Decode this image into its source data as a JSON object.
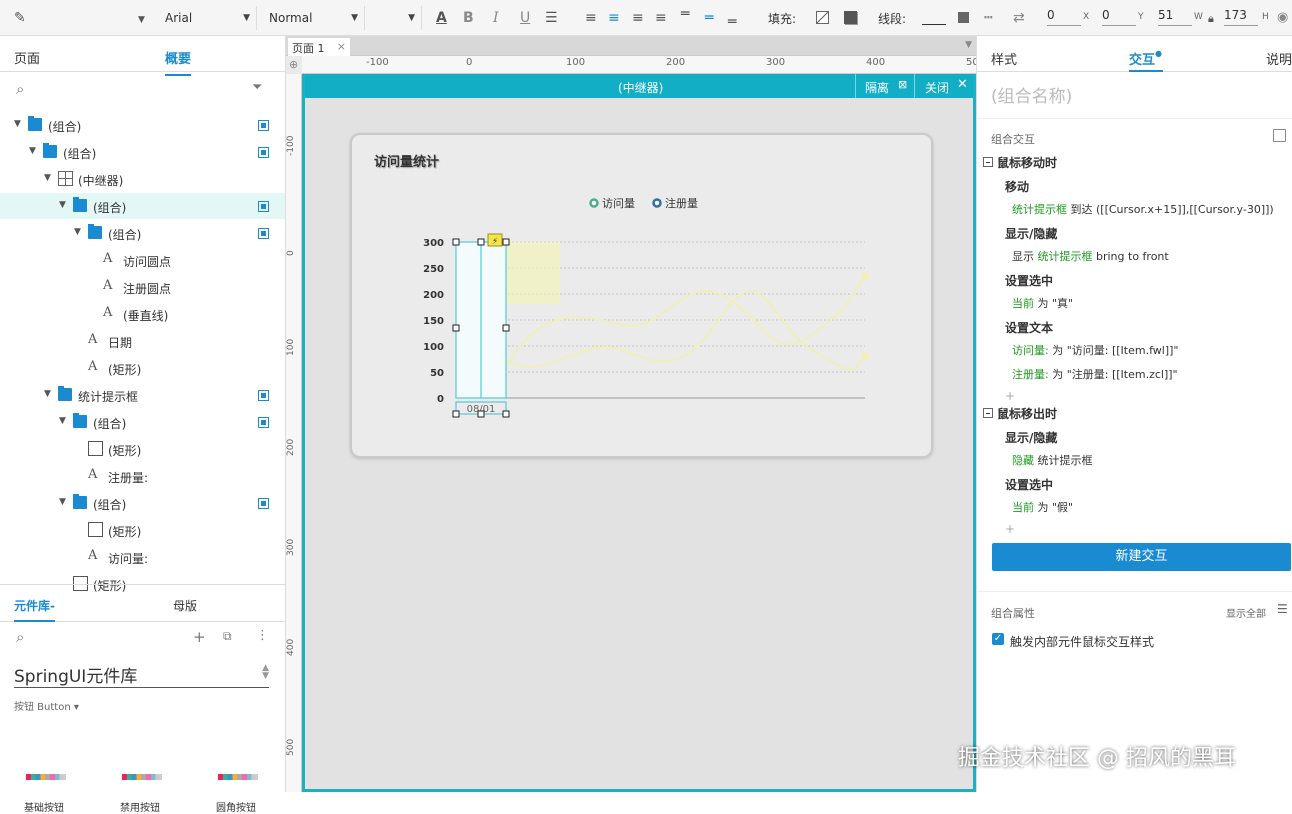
{
  "toolbar": {
    "font_family": "Arial",
    "font_style": "Normal",
    "fill_label": "填充:",
    "stroke_label": "线段:",
    "x_value": "0",
    "x_unit": "X",
    "y_value": "0",
    "y_unit": "Y",
    "w_value": "51",
    "w_unit": "W",
    "h_value": "173",
    "h_unit": "H"
  },
  "left": {
    "tab_pages": "页面",
    "tab_outline": "概要",
    "tree": [
      {
        "label": "(组合)",
        "icon": "folder"
      },
      {
        "label": "(组合)",
        "icon": "folder"
      },
      {
        "label": "(中继器)",
        "icon": "repeater"
      },
      {
        "label": "(组合)",
        "icon": "folder"
      },
      {
        "label": "(组合)",
        "icon": "folder"
      },
      {
        "label": "访问圆点",
        "icon": "text"
      },
      {
        "label": "注册圆点",
        "icon": "text"
      },
      {
        "label": "(垂直线)",
        "icon": "text"
      },
      {
        "label": "日期",
        "icon": "text"
      },
      {
        "label": "(矩形)",
        "icon": "text"
      },
      {
        "label": "统计提示框",
        "icon": "folder"
      },
      {
        "label": "(组合)",
        "icon": "folder"
      },
      {
        "label": "(矩形)",
        "icon": "rect"
      },
      {
        "label": "注册量:",
        "icon": "text"
      },
      {
        "label": "(组合)",
        "icon": "folder"
      },
      {
        "label": "(矩形)",
        "icon": "rect"
      },
      {
        "label": "访问量:",
        "icon": "text"
      },
      {
        "label": "(矩形)",
        "icon": "rect"
      }
    ],
    "lib_tab": "元件库-",
    "master_tab": "母版",
    "library_name": "SpringUI元件库",
    "category": "按钮 Button ▾",
    "widgets": [
      "基础按钮",
      "禁用按钮",
      "圆角按钮"
    ]
  },
  "canvas": {
    "page_tab": "页面 1",
    "page_tab_close": "×",
    "ruler_h": [
      "-100",
      "0",
      "100",
      "200",
      "300",
      "400",
      "500"
    ],
    "ruler_v": [
      "-100",
      "0",
      "100",
      "200",
      "300",
      "400",
      "500"
    ],
    "repeater_title": "(中继器)",
    "isolate_label": "隔离",
    "close_label": "关闭",
    "chart_title": "访问量统计",
    "legend": [
      "访问量",
      "注册量"
    ],
    "date_label": "08/01",
    "lightning_icon": "⚡"
  },
  "chart_data": {
    "type": "line",
    "title": "访问量统计",
    "ylim": [
      0,
      300
    ],
    "yticks": [
      "300",
      "250",
      "200",
      "150",
      "100",
      "50",
      "0"
    ],
    "x_label_shown": "08/01",
    "series": [
      {
        "name": "访问量",
        "color": "#4caf87"
      },
      {
        "name": "注册量",
        "color": "#2f6fa5"
      }
    ],
    "grid": true,
    "legend_position": "top-center"
  },
  "right": {
    "tab_style": "样式",
    "tab_interaction": "交互",
    "tab_notes": "说明",
    "name_placeholder": "(组合名称)",
    "group_interactions": "组合交互",
    "events": [
      {
        "event": "鼠标移动时",
        "actions": [
          {
            "title": "移动",
            "lines": [
              [
                "统计提示框",
                " 到达 ([[Cursor.x+15]],[[Cursor.y-30]])"
              ]
            ]
          },
          {
            "title": "显示/隐藏",
            "lines": [
              [
                "显示 ",
                "统计提示框",
                " bring to front"
              ]
            ]
          },
          {
            "title": "设置选中",
            "lines": [
              [
                "当前",
                " 为 \"真\""
              ]
            ]
          },
          {
            "title": "设置文本",
            "lines": [
              [
                "访问量:",
                " 为 \"访问量: [[Item.fwl]]\""
              ],
              [
                "注册量:",
                " 为 \"注册量: [[Item.zcl]]\""
              ]
            ]
          }
        ]
      },
      {
        "event": "鼠标移出时",
        "actions": [
          {
            "title": "显示/隐藏",
            "lines": [
              [
                "隐藏 ",
                "统计提示框"
              ]
            ]
          },
          {
            "title": "设置选中",
            "lines": [
              [
                "当前",
                " 为 \"假\""
              ]
            ]
          }
        ]
      }
    ],
    "plus": "+",
    "new_interaction": "新建交互",
    "group_props": "组合属性",
    "show_all": "显示全部",
    "checkbox_label": "触发内部元件鼠标交互样式",
    "checkbox_checked": true
  },
  "watermark": "掘金技术社区 @ 招风的黑耳",
  "colors": {
    "accent": "#1a8bd0",
    "repeater": "#12aec6",
    "green_text": "#1e9a1e",
    "selected_row": "#e4f7f7"
  }
}
